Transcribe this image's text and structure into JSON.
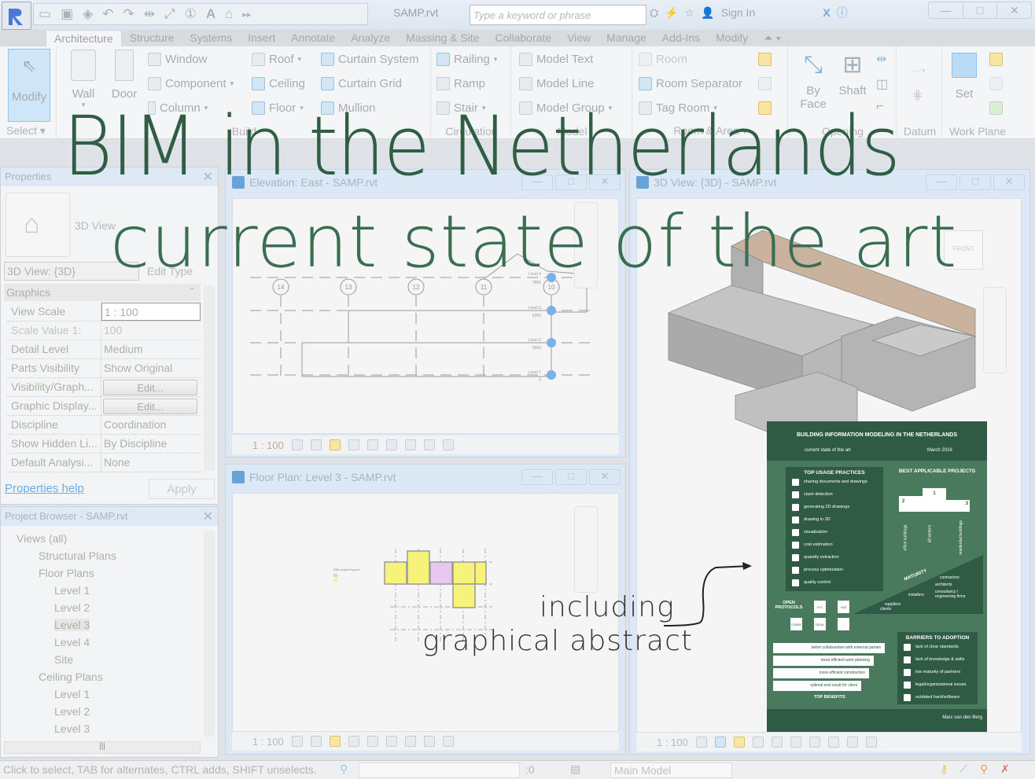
{
  "app": {
    "document_title": "SAMP.rvt",
    "search_placeholder": "Type a keyword or phrase",
    "sign_in": "Sign In",
    "window_controls": [
      "—",
      "□",
      "✕"
    ]
  },
  "overlay": {
    "headline": "BIM in the Netherlands",
    "subheadline": "current state of the art",
    "note_line1": "including",
    "note_line2": "graphical abstract"
  },
  "ribbon_tabs": [
    "Architecture",
    "Structure",
    "Systems",
    "Insert",
    "Annotate",
    "Analyze",
    "Massing & Site",
    "Collaborate",
    "View",
    "Manage",
    "Add-Ins",
    "Modify"
  ],
  "ribbon": {
    "select": {
      "button": "Modify",
      "title": "Select ▾"
    },
    "build": {
      "title": "Build",
      "wall": "Wall",
      "door": "Door",
      "window": "Window",
      "component": "Component",
      "column": "Column",
      "roof": "Roof",
      "ceiling": "Ceiling",
      "floor": "Floor",
      "curtain_system": "Curtain  System",
      "curtain_grid": "Curtain  Grid",
      "mullion": "Mullion"
    },
    "circulation": {
      "title": "Circulation",
      "railing": "Railing",
      "ramp": "Ramp",
      "stair": "Stair"
    },
    "model": {
      "title": "Model",
      "text": "Model  Text",
      "line": "Model  Line",
      "group": "Model  Group"
    },
    "room_area": {
      "title": "Room & Area ▾",
      "room": "Room",
      "separator": "Room  Separator",
      "tag": "Tag  Room"
    },
    "opening": {
      "title": "Opening",
      "by_face_1": "By",
      "by_face_2": "Face",
      "shaft": "Shaft"
    },
    "datum": {
      "title": "Datum"
    },
    "work_plane": {
      "title": "Work Plane",
      "set": "Set"
    }
  },
  "properties": {
    "title": "Properties",
    "type_name": "3D View",
    "instance": "3D View: {3D}",
    "edit_type": "Edit Type",
    "section": "Graphics",
    "rows": [
      {
        "k": "View Scale",
        "v": "1 : 100"
      },
      {
        "k": "Scale Value    1:",
        "v": "100"
      },
      {
        "k": "Detail Level",
        "v": "Medium"
      },
      {
        "k": "Parts Visibility",
        "v": "Show Original"
      },
      {
        "k": "Visibility/Graph...",
        "v": "Edit..."
      },
      {
        "k": "Graphic Display...",
        "v": "Edit..."
      },
      {
        "k": "Discipline",
        "v": "Coordination"
      },
      {
        "k": "Show Hidden Li...",
        "v": "By Discipline"
      },
      {
        "k": "Default Analysi...",
        "v": "None"
      }
    ],
    "help_link": "Properties help",
    "apply": "Apply"
  },
  "browser": {
    "title": "Project Browser - SAMP.rvt",
    "items": [
      {
        "label": "Views (all)",
        "level": 0
      },
      {
        "label": "Structural Plans",
        "level": 1
      },
      {
        "label": "Floor Plans",
        "level": 1
      },
      {
        "label": "Level 1",
        "level": 2
      },
      {
        "label": "Level 2",
        "level": 2
      },
      {
        "label": "Level 3",
        "level": 2,
        "selected": true
      },
      {
        "label": "Level 4",
        "level": 2
      },
      {
        "label": "Site",
        "level": 2
      },
      {
        "label": "Ceiling Plans",
        "level": 1
      },
      {
        "label": "Level 1",
        "level": 2
      },
      {
        "label": "Level 2",
        "level": 2
      },
      {
        "label": "Level 3",
        "level": 2
      }
    ]
  },
  "views": {
    "elevation": {
      "title": "Elevation: East - SAMP.rvt",
      "scale": "1 : 100",
      "grids": [
        "14",
        "13",
        "12",
        "11",
        "10"
      ],
      "levels": [
        {
          "name": "Level 4",
          "elev": "7800"
        },
        {
          "name": "Level 3",
          "elev": "5200"
        },
        {
          "name": "Level 2",
          "elev": "2600"
        },
        {
          "name": "Level 1",
          "elev": "0"
        }
      ]
    },
    "floorplan": {
      "title": "Floor Plan: Level 3 - SAMP.rvt",
      "scale": "1 : 100"
    },
    "view3d": {
      "title": "3D View: {3D} - SAMP.rvt",
      "scale": "1 : 100"
    }
  },
  "abstract": {
    "title": "BUILDING INFORMATION MODELING IN THE NETHERLANDS",
    "subtitle": "current state of the art",
    "date": "March 2016",
    "usage_title": "TOP USAGE PRACTICES",
    "usage": [
      "sharing documents and drawings",
      "clash detection",
      "generating 2D drawings",
      "drawing in 3D",
      "visualization",
      "cost estimation",
      "quantity extraction",
      "process optimization",
      "quality control"
    ],
    "projects_title": "BEST APPLICABLE PROJECTS",
    "projects": [
      {
        "rank": "2",
        "label": "office buildings"
      },
      {
        "rank": "1",
        "label": "all sectors"
      },
      {
        "rank": "3",
        "label": "residential buildings"
      }
    ],
    "maturity": "MATURITY",
    "maturity_actors": [
      "contractors",
      "architects",
      "consultancy / engineering firms",
      "installers",
      "suppliers",
      "clients"
    ],
    "protocols_title": "OPEN PROTOCOLS",
    "protocols": [
      "IFC",
      "VISI",
      "COINS",
      "CB-NL",
      "..."
    ],
    "benefits": [
      "better collaboration with external parties",
      "more efficient work planning",
      "more efficient construction",
      "optimal end result for client"
    ],
    "benefits_title": "TOP BENEFITS",
    "barriers_title": "BARRIERS TO ADOPTION",
    "barriers": [
      "lack of clear standards",
      "lack of knowledge & skills",
      "low maturity of partners",
      "legal/organizational issues",
      "outdated hard/software"
    ],
    "author": "Marc van den Berg"
  },
  "status": {
    "hint": "Click to select, TAB for alternates, CTRL adds, SHIFT unselects.",
    "count": ":0",
    "model": "Main Model"
  }
}
